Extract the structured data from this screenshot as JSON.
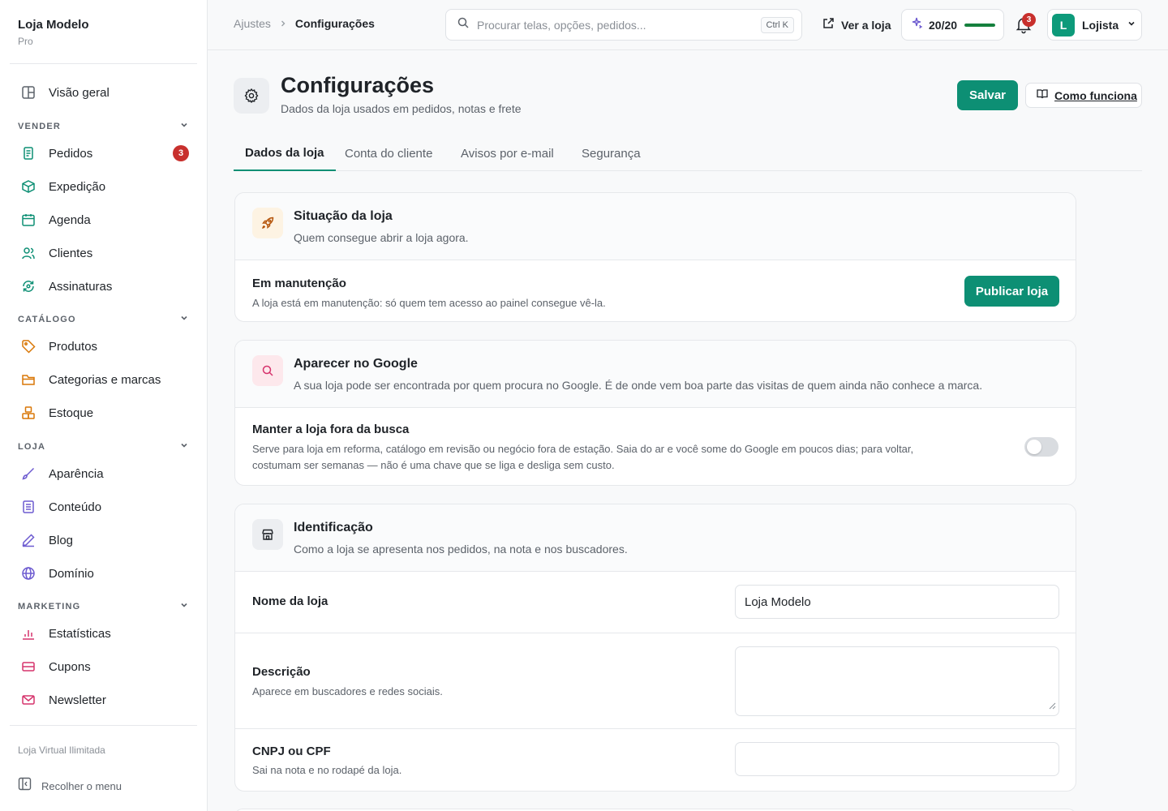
{
  "brand": {
    "name": "Loja Modelo",
    "plan": "Pro"
  },
  "sidebar": {
    "overview": "Visão geral",
    "sections": {
      "vender": "VENDER",
      "catalogo": "CATÁLOGO",
      "loja": "LOJA",
      "marketing": "MARKETING"
    },
    "items": {
      "pedidos": "Pedidos",
      "pedidos_badge": "3",
      "expedicao": "Expedição",
      "agenda": "Agenda",
      "clientes": "Clientes",
      "assinaturas": "Assinaturas",
      "produtos": "Produtos",
      "categorias": "Categorias e marcas",
      "estoque": "Estoque",
      "aparencia": "Aparência",
      "conteudo": "Conteúdo",
      "blog": "Blog",
      "dominio": "Domínio",
      "estatisticas": "Estatísticas",
      "cupons": "Cupons",
      "newsletter": "Newsletter"
    },
    "footer": "Loja Virtual Ilimitada",
    "collapse": "Recolher o menu"
  },
  "topbar": {
    "breadcrumb": [
      "Ajustes",
      "Configurações"
    ],
    "search_placeholder": "Procurar telas, opções, pedidos...",
    "search_shortcut": "Ctrl K",
    "view_store": "Ver a loja",
    "quota": "20/20",
    "quota_fraction": 1.0,
    "notifications": "3",
    "user_initial": "L",
    "user_name": "Lojista"
  },
  "header": {
    "title": "Configurações",
    "subtitle": "Dados da loja usados em pedidos, notas e frete",
    "save": "Salvar",
    "how": "Como funciona"
  },
  "tabs": [
    "Dados da loja",
    "Conta do cliente",
    "Avisos por e-mail",
    "Segurança"
  ],
  "cards": {
    "status": {
      "title": "Situação da loja",
      "subtitle": "Quem consegue abrir a loja agora.",
      "row_title": "Em manutenção",
      "row_desc": "A loja está em manutenção: só quem tem acesso ao painel consegue vê-la.",
      "button": "Publicar loja"
    },
    "google": {
      "title": "Aparecer no Google",
      "subtitle": "A sua loja pode ser encontrada por quem procura no Google. É de onde vem boa parte das visitas de quem ainda não conhece a marca.",
      "row_title": "Manter a loja fora da busca",
      "row_desc_1": "Serve para loja em reforma, catálogo em revisão ou negócio fora de estação. Saia do ar e você some do Google em poucos dias; para voltar,",
      "row_desc_2": "costumam ser semanas — não é uma chave que se liga e desliga sem custo.",
      "toggle_on": false
    },
    "identity": {
      "title": "Identificação",
      "subtitle": "Como a loja se apresenta nos pedidos, na nota e nos buscadores.",
      "name_label": "Nome da loja",
      "name_value": "Loja Modelo",
      "desc_label": "Descrição",
      "desc_help": "Aparece em buscadores e redes sociais.",
      "desc_value": "",
      "doc_label": "CNPJ ou CPF",
      "doc_help": "Sai na nota e no rodapé da loja.",
      "doc_value": ""
    }
  },
  "colors": {
    "accent": "#0d8f74",
    "badge": "#c8302d"
  }
}
